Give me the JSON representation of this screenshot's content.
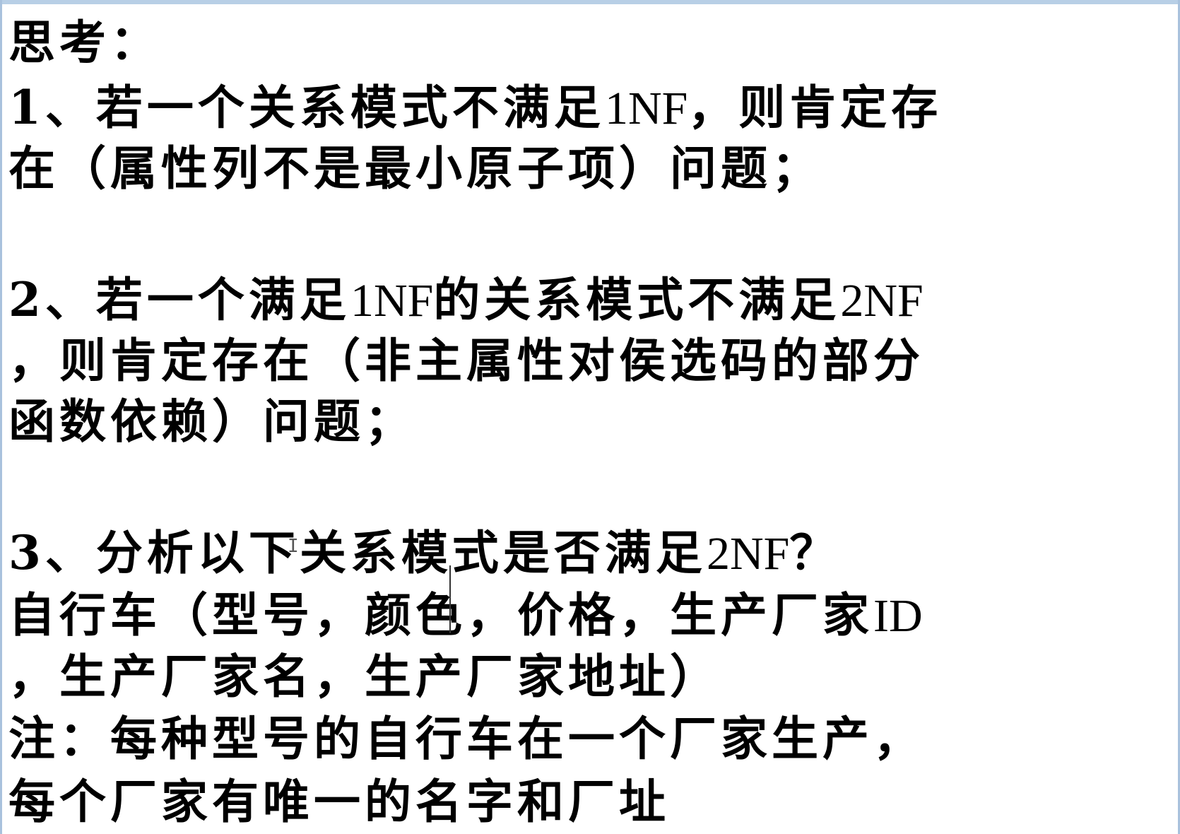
{
  "document": {
    "title": "思考：",
    "question1": {
      "line1_prefix": "1、若一个关系模式不满足",
      "line1_latin": "1NF",
      "line1_suffix": "，则肯定存",
      "line2": "在（属性列不是最小原子项）问题；"
    },
    "question2": {
      "line1_prefix": "2、若一个满足",
      "line1_latin1": "1NF",
      "line1_mid": "的关系模式不满足",
      "line1_latin2": "2NF",
      "line2": "，则肯定存在（非主属性对侯选码的部分",
      "line3": "函数依赖）问题；"
    },
    "question3": {
      "line1_prefix": "3、分析以下关系模式是否满足",
      "line1_latin": "2NF",
      "line1_suffix": "？",
      "line2_prefix": "自行车（型号，颜色，价格，生产厂家",
      "line2_latin": "ID",
      "line3": "，生产厂家名，生产厂家地址）"
    },
    "note": {
      "line1": "注：每种型号的自行车在一个厂家生产，",
      "line2": "每个厂家有唯一的名字和厂址"
    }
  }
}
